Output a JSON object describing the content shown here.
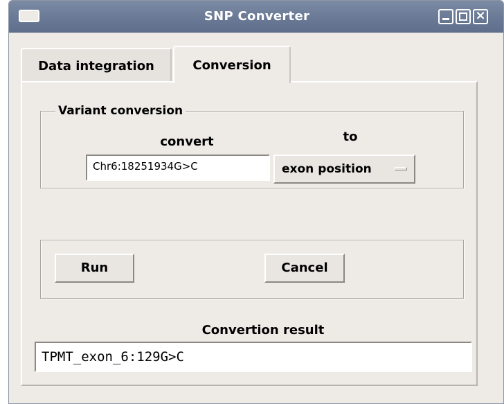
{
  "window": {
    "title": "SNP Converter"
  },
  "tabs": [
    {
      "label": "Data integration",
      "active": false
    },
    {
      "label": "Conversion",
      "active": true
    }
  ],
  "variant_group": {
    "legend": "Variant conversion",
    "convert_label": "convert",
    "to_label": "to",
    "input_value": "Chr6:18251934G>C",
    "target_selected": "exon position"
  },
  "actions": {
    "run_label": "Run",
    "cancel_label": "Cancel"
  },
  "result": {
    "label": "Convertion result",
    "value": "TPMT_exon_6:129G>C"
  },
  "icons": {
    "system_menu": "window-menu-icon",
    "minimize": "minimize-icon",
    "maximize": "maximize-icon",
    "close": "close-icon",
    "option_indicator": "option-menu-indicator-icon"
  },
  "colors": {
    "titlebar": "#6a7a96",
    "window_bg": "#eeebe7",
    "field_bg": "#ffffff"
  }
}
